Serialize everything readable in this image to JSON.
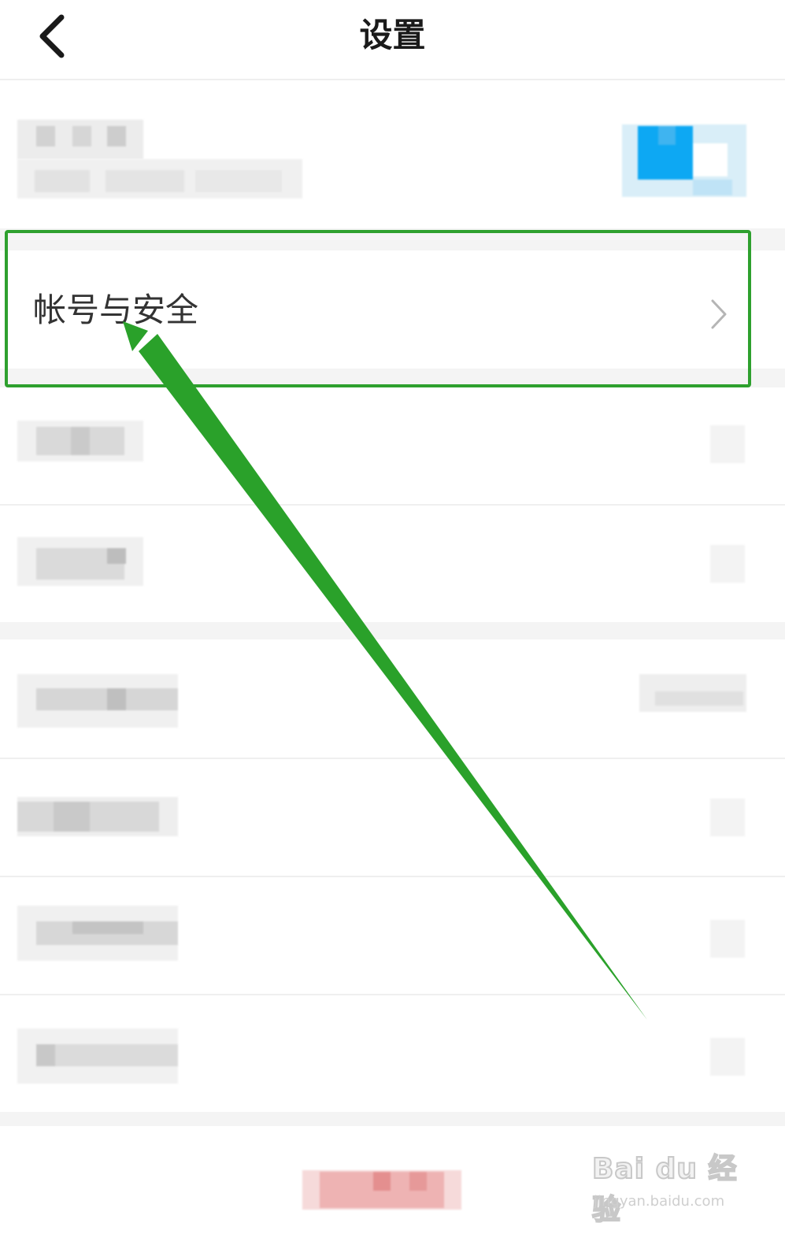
{
  "header": {
    "title": "设置",
    "back_icon": "chevron-left-icon"
  },
  "account_row": {
    "label": "帐号与安全",
    "chevron_icon": "chevron-right-icon"
  },
  "watermark": {
    "text": "Bai du 经验",
    "url": "jingyan.baidu.com"
  },
  "colors": {
    "highlight_green": "#2ea02e",
    "arrow_green": "#2aa12a",
    "separator": "#efefef",
    "section_gap": "#f4f4f4"
  }
}
